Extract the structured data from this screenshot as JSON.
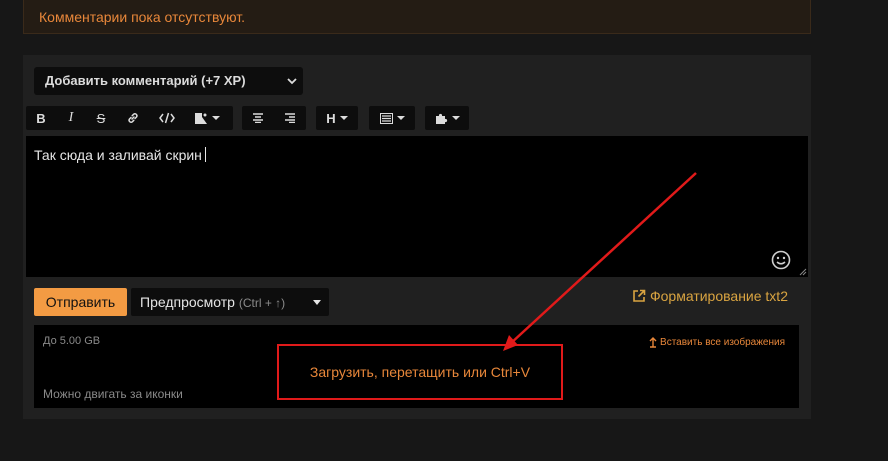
{
  "notice": {
    "text": "Комментарии пока отсутствуют."
  },
  "comment_form": {
    "type_select": {
      "value": "Добавить комментарий (+7 XP)"
    },
    "toolbar": {
      "bold": "B",
      "italic": "I",
      "strike": "S",
      "heading": "H"
    },
    "editor": {
      "text": "Так сюда и заливай скрин"
    },
    "send_button": "Отправить",
    "preview_button": {
      "label": "Предпросмотр",
      "hint": "(Ctrl + ↑)"
    },
    "format_link": "Форматирование txt2",
    "upload": {
      "max_size": "До 5.00 GB",
      "move_hint": "Можно двигать за иконки",
      "insert_all": "Вставить все изображения",
      "drop_label": "Загрузить, перетащить или Ctrl+V"
    }
  },
  "colors": {
    "accent": "#f39b43",
    "annotation": "#e11a1a",
    "link": "#d9a441"
  }
}
